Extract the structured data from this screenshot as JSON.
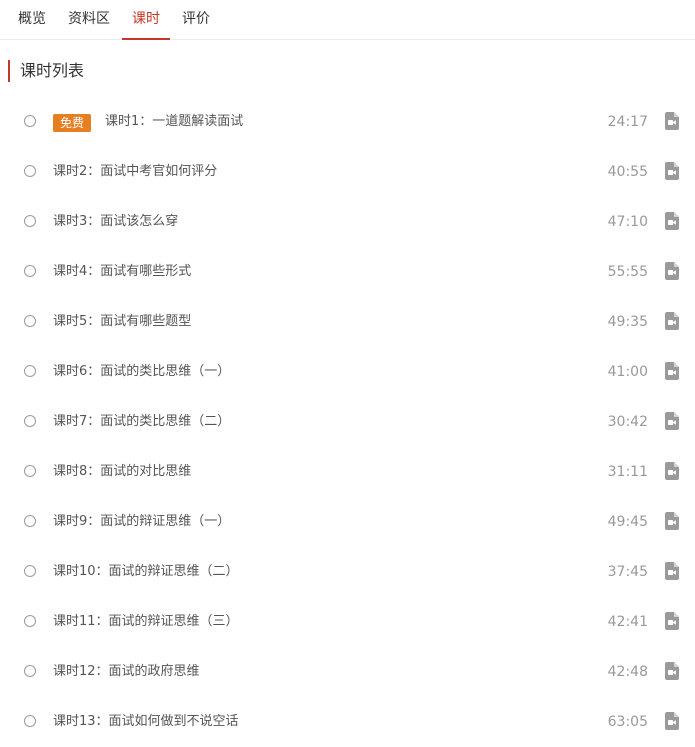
{
  "tabs": [
    {
      "label": "概览"
    },
    {
      "label": "资料区"
    },
    {
      "label": "课时"
    },
    {
      "label": "评价"
    }
  ],
  "active_tab": "课时",
  "section": {
    "title": "课时列表"
  },
  "lessons": [
    {
      "title": "课时1：一道题解读面试",
      "duration": "24:17",
      "badge": "免费"
    },
    {
      "title": "课时2：面试中考官如何评分",
      "duration": "40:55"
    },
    {
      "title": "课时3：面试该怎么穿",
      "duration": "47:10"
    },
    {
      "title": "课时4：面试有哪些形式",
      "duration": "55:55"
    },
    {
      "title": "课时5：面试有哪些题型",
      "duration": "49:35"
    },
    {
      "title": "课时6：面试的类比思维（一）",
      "duration": "41:00"
    },
    {
      "title": "课时7：面试的类比思维（二）",
      "duration": "30:42"
    },
    {
      "title": "课时8：面试的对比思维",
      "duration": "31:11"
    },
    {
      "title": "课时9：面试的辩证思维（一）",
      "duration": "49:45"
    },
    {
      "title": "课时10：面试的辩证思维（二）",
      "duration": "37:45"
    },
    {
      "title": "课时11：面试的辩证思维（三）",
      "duration": "42:41"
    },
    {
      "title": "课时12：面试的政府思维",
      "duration": "42:48"
    },
    {
      "title": "课时13：面试如何做到不说空话",
      "duration": "63:05"
    }
  ],
  "icons": {
    "status": "radio-circle-icon",
    "media": "video-file-icon"
  },
  "colors": {
    "accent": "#c0392b",
    "badge": "#e67e22",
    "text": "#555555",
    "muted": "#999999",
    "icon": "#9a9a9a"
  }
}
